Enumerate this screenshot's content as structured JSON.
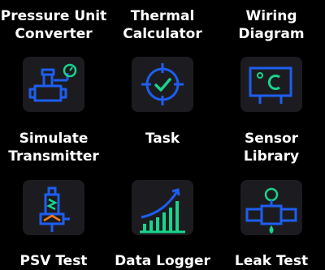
{
  "row0": {
    "c1": {
      "line1": "Pressure Unit",
      "line2": "Converter"
    },
    "c2": {
      "line1": "Thermal",
      "line2": "Calculator"
    },
    "c3": {
      "line1": "Wiring",
      "line2": "Diagram"
    }
  },
  "row1": {
    "c1": {
      "line1": "Simulate",
      "line2": "Transmitter",
      "icon": "pressure-transmitter-icon"
    },
    "c2": {
      "line1": "Task",
      "icon": "task-target-check-icon"
    },
    "c3": {
      "line1": "Sensor",
      "line2": "Library",
      "icon": "thermometer-celsius-board-icon"
    }
  },
  "row2": {
    "c1": {
      "line1": "PSV Test",
      "icon": "safety-valve-icon"
    },
    "c2": {
      "line1": "Data Logger",
      "icon": "bar-chart-trend-icon"
    },
    "c3": {
      "line1": "Leak Test",
      "icon": "pipe-leak-icon"
    }
  },
  "colors": {
    "background": "#000000",
    "tile": "#1c1c20",
    "blue": "#1e5ef0",
    "green": "#19d48c",
    "orange": "#f07a1e",
    "text": "#ffffff"
  }
}
